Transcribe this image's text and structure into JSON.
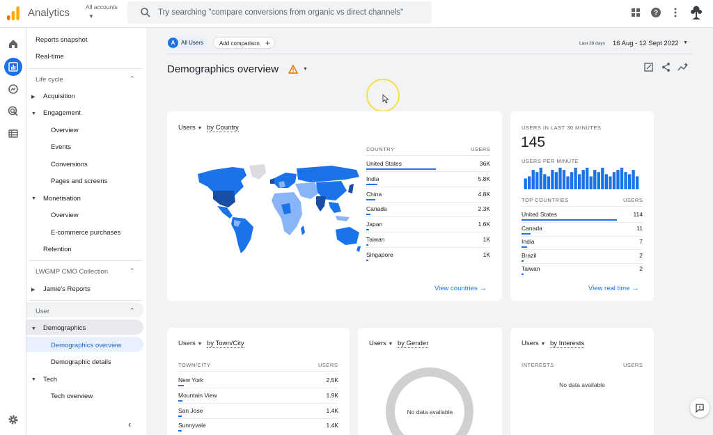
{
  "app": {
    "title": "Analytics",
    "account_label": "All accounts",
    "search_placeholder": "Try searching \"compare conversions from organic vs direct channels\""
  },
  "nav": {
    "reports_snapshot": "Reports snapshot",
    "realtime": "Real-time",
    "lifecycle": "Life cycle",
    "acquisition": "Acquisition",
    "engagement": "Engagement",
    "engagement_overview": "Overview",
    "events": "Events",
    "conversions": "Conversions",
    "pages_screens": "Pages and screens",
    "monetisation": "Monetisation",
    "monetisation_overview": "Overview",
    "ecommerce": "E-commerce purchases",
    "retention": "Retention",
    "collection": "LWGMP CMO Collection",
    "jamies_reports": "Jamie's Reports",
    "user": "User",
    "demographics": "Demographics",
    "demographics_overview": "Demographics overview",
    "demographic_details": "Demographic details",
    "tech": "Tech",
    "tech_overview": "Tech overview"
  },
  "toolbar": {
    "all_users_badge": "A",
    "all_users": "All Users",
    "add_comparison": "Add comparison",
    "date_range_label": "Last 28 days",
    "date_range": "16 Aug - 12 Sept 2022"
  },
  "page": {
    "title": "Demographics overview"
  },
  "country_card": {
    "metric": "Users",
    "dimension": "by Country",
    "col_dim": "COUNTRY",
    "col_metric": "USERS",
    "rows": [
      {
        "name": "United States",
        "value": "36K",
        "fraction": 1.0
      },
      {
        "name": "India",
        "value": "5.8K",
        "fraction": 0.16
      },
      {
        "name": "China",
        "value": "4.8K",
        "fraction": 0.13
      },
      {
        "name": "Canada",
        "value": "2.3K",
        "fraction": 0.064
      },
      {
        "name": "Japan",
        "value": "1.6K",
        "fraction": 0.044
      },
      {
        "name": "Taiwan",
        "value": "1K",
        "fraction": 0.028
      },
      {
        "name": "Singapore",
        "value": "1K",
        "fraction": 0.028
      }
    ],
    "link": "View countries"
  },
  "realtime_card": {
    "label": "USERS IN LAST 30 MINUTES",
    "value": "145",
    "per_minute_label": "USERS PER MINUTE",
    "per_minute": [
      5,
      6,
      9,
      8,
      10,
      7,
      6,
      9,
      8,
      10,
      9,
      6,
      8,
      10,
      7,
      9,
      10,
      6,
      9,
      8,
      10,
      7,
      6,
      8,
      9,
      10,
      8,
      7,
      9,
      6
    ],
    "col_dim": "TOP COUNTRIES",
    "col_metric": "USERS",
    "rows": [
      {
        "name": "United States",
        "value": "114",
        "fraction": 1.0
      },
      {
        "name": "Canada",
        "value": "11",
        "fraction": 0.096
      },
      {
        "name": "India",
        "value": "7",
        "fraction": 0.061
      },
      {
        "name": "Brazil",
        "value": "2",
        "fraction": 0.018
      },
      {
        "name": "Taiwan",
        "value": "2",
        "fraction": 0.018
      }
    ],
    "link": "View real time"
  },
  "city_card": {
    "metric": "Users",
    "dimension": "by Town/City",
    "col_dim": "TOWN/CITY",
    "col_metric": "USERS",
    "rows": [
      {
        "name": "New York",
        "value": "2.5K",
        "fraction": 0.1
      },
      {
        "name": "Mountain View",
        "value": "1.9K",
        "fraction": 0.08
      },
      {
        "name": "San Jose",
        "value": "1.4K",
        "fraction": 0.06
      },
      {
        "name": "Sunnyvale",
        "value": "1.4K",
        "fraction": 0.06
      }
    ]
  },
  "gender_card": {
    "metric": "Users",
    "dimension": "by Gender",
    "empty": "No data available"
  },
  "interests_card": {
    "metric": "Users",
    "dimension": "by Interests",
    "col_dim": "INTERESTS",
    "col_metric": "USERS",
    "empty": "No data available"
  },
  "colors": {
    "accent": "#1a73e8",
    "map_dark": "#174ea6",
    "map_mid": "#1a73e8",
    "map_light": "#8ab4f8",
    "map_none": "#dadce0",
    "warning": "#f9ab00"
  }
}
